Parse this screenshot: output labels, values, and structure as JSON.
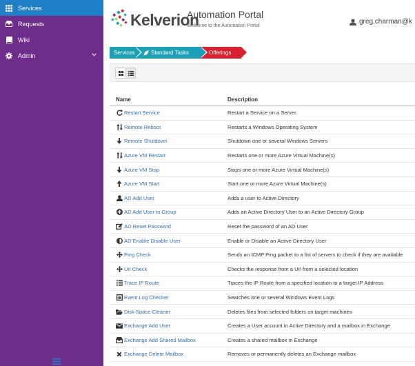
{
  "sidebar": {
    "items": [
      {
        "label": "Services",
        "icon": "grid-icon"
      },
      {
        "label": "Requests",
        "icon": "inbox-icon"
      },
      {
        "label": "Wiki",
        "icon": "book-icon"
      },
      {
        "label": "Admin",
        "icon": "gear-icon"
      }
    ],
    "active_color": "#1f7fc6",
    "background_color": "#6e2d8a"
  },
  "header": {
    "logo_text": "Kelverion",
    "title": "Automation Portal",
    "subtitle": "Welcome to the Automation Portal",
    "user": "greg.charman@k"
  },
  "breadcrumb": {
    "items": [
      "Services",
      "Standard Tasks",
      "Offerings"
    ]
  },
  "table": {
    "headers": {
      "name": "Name",
      "description": "Description"
    },
    "rows": [
      {
        "name": "Restart Service",
        "description": "Restart a Service on a Server",
        "icon": "refresh-icon"
      },
      {
        "name": "Remote Reboot",
        "description": "Restarts a Windows Operating System",
        "icon": "sort-arrows-icon"
      },
      {
        "name": "Remote Shutdown",
        "description": "Shutdown one or several Windows Servers",
        "icon": "arrow-down-icon"
      },
      {
        "name": "Azure VM Restart",
        "description": "Restarts one or more Azure Virtual Machine(s)",
        "icon": "sort-arrows-icon"
      },
      {
        "name": "Azure VM Stop",
        "description": "Stops one or more Azure Virtual Machine(s)",
        "icon": "arrow-down-icon"
      },
      {
        "name": "Azure VM Start",
        "description": "Start one or more Azure Virtual Machine(s)",
        "icon": "arrow-up-icon"
      },
      {
        "name": "AD Add User",
        "description": "Adds a user to Active Directory",
        "icon": "user-icon"
      },
      {
        "name": "AD Add User to Group",
        "description": "Adds an Active Directory User to an Active Directory Group",
        "icon": "plus-circle-icon"
      },
      {
        "name": "AD Reset Password",
        "description": "Reset the password of an AD User",
        "icon": "edit-icon"
      },
      {
        "name": "AD Enable Disable User",
        "description": "Enable or Disable an Active Directory User",
        "icon": "half-circle-icon"
      },
      {
        "name": "Ping Check",
        "description": "Sends an ICMP Ping packet to a list of servers to check if they are available",
        "icon": "move-arrows-icon"
      },
      {
        "name": "Url Check",
        "description": "Checks the response from a Url from a selected location",
        "icon": "move-arrows-icon"
      },
      {
        "name": "Trace IP Route",
        "description": "Traces the IP Route from a specified location to a target IP Address",
        "icon": "list-icon"
      },
      {
        "name": "Event Log Checker",
        "description": "Searches one or several Windows Event Logs",
        "icon": "log-icon"
      },
      {
        "name": "Disk Space Cleaner",
        "description": "Deletes files from selected folders on target machines",
        "icon": "folder-open-icon"
      },
      {
        "name": "Exchange Add User",
        "description": "Creates a User account in Active Directory and a mailbox in Exchange",
        "icon": "envelope-icon"
      },
      {
        "name": "Exchange Add Shared Mailbox",
        "description": "Creates a shared mailbox in Exchange",
        "icon": "inbox-tray-icon"
      },
      {
        "name": "Exchange Delete Mailbox",
        "description": "Removes or permanently deletes an Exchange mailbox",
        "icon": "close-icon"
      }
    ]
  }
}
